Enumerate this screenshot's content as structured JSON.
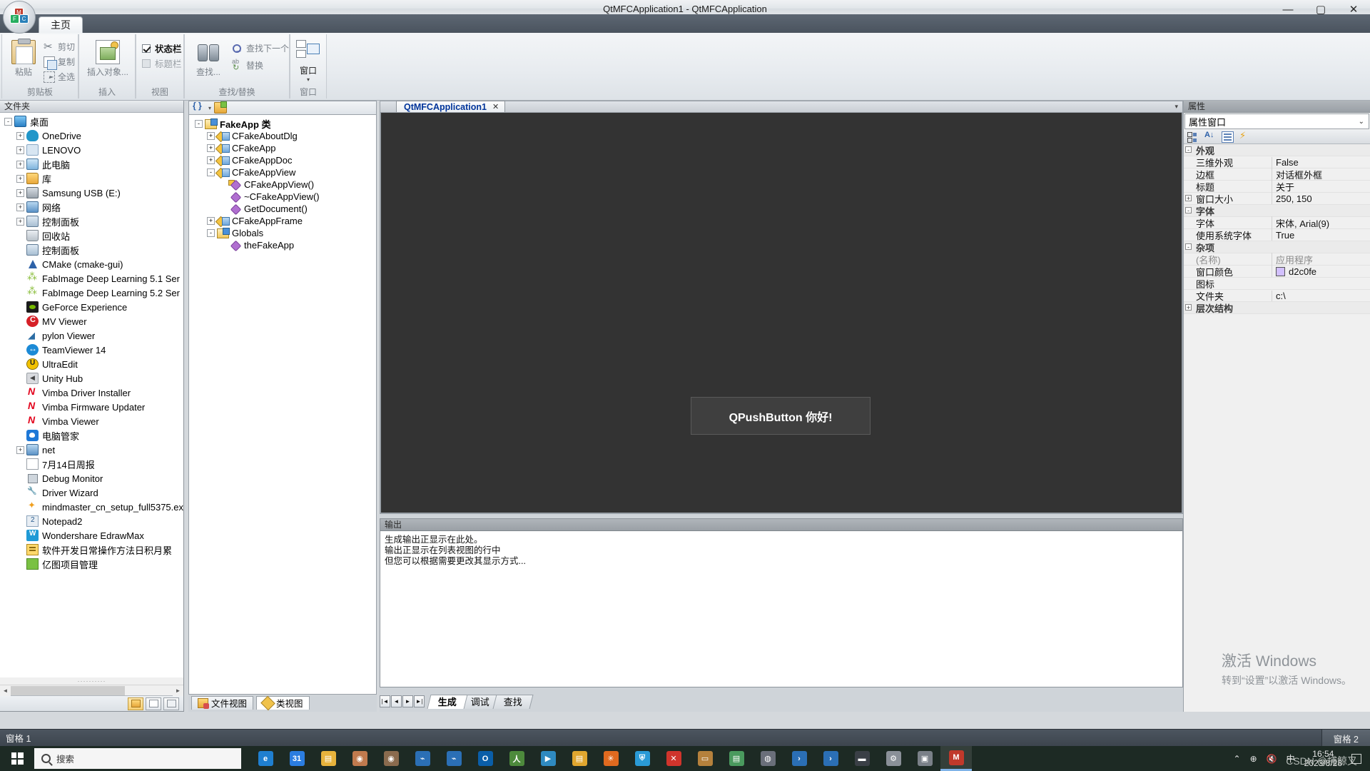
{
  "titlebar": {
    "title": "QtMFCApplication1 - QtMFCApplication",
    "minimize": "—",
    "maximize": "▢",
    "close": "✕"
  },
  "quick_access": {
    "new_label": "new-file",
    "open_label": "open-file",
    "save_label": "save-file",
    "print_label": "print",
    "more_caret": "▾"
  },
  "ribbon": {
    "tab": "主页",
    "groups": [
      {
        "name": "剪贴板"
      },
      {
        "name": "插入"
      },
      {
        "name": "视图"
      },
      {
        "name": "查找/替换"
      },
      {
        "name": "窗口"
      }
    ],
    "clipboard": {
      "paste": "粘贴",
      "cut": "剪切",
      "copy": "复制",
      "select_all": "全选"
    },
    "insert": {
      "insert_object": "插入对象..."
    },
    "view": {
      "status_bar": "状态栏",
      "title_bar": "标题栏",
      "status_bar_checked": true,
      "title_bar_checked": false
    },
    "find": {
      "find": "查找...",
      "find_next": "查找下一个",
      "replace": "替换"
    },
    "window": {
      "window": "窗口",
      "caret": "▾"
    }
  },
  "folder_pane": {
    "caption": "文件夹",
    "tree": [
      {
        "label": "桌面",
        "depth": 0,
        "expander": "-",
        "icon": "i-monitor"
      },
      {
        "label": "OneDrive",
        "depth": 1,
        "expander": "+",
        "icon": "i-cloud"
      },
      {
        "label": "LENOVO",
        "depth": 1,
        "expander": "+",
        "icon": "i-user"
      },
      {
        "label": "此电脑",
        "depth": 1,
        "expander": "+",
        "icon": "i-pc"
      },
      {
        "label": "库",
        "depth": 1,
        "expander": "+",
        "icon": "i-lib"
      },
      {
        "label": "Samsung USB (E:)",
        "depth": 1,
        "expander": "+",
        "icon": "i-usb"
      },
      {
        "label": "网络",
        "depth": 1,
        "expander": "+",
        "icon": "i-net"
      },
      {
        "label": "控制面板",
        "depth": 1,
        "expander": "+",
        "icon": "i-cp"
      },
      {
        "label": "回收站",
        "depth": 1,
        "expander": "",
        "icon": "i-bin"
      },
      {
        "label": "控制面板",
        "depth": 1,
        "expander": "",
        "icon": "i-cp"
      },
      {
        "label": "CMake (cmake-gui)",
        "depth": 1,
        "expander": "",
        "icon": "i-cmake"
      },
      {
        "label": "FabImage Deep Learning 5.1 Ser",
        "depth": 1,
        "expander": "",
        "icon": "i-fab"
      },
      {
        "label": "FabImage Deep Learning 5.2 Ser",
        "depth": 1,
        "expander": "",
        "icon": "i-fab"
      },
      {
        "label": "GeForce Experience",
        "depth": 1,
        "expander": "",
        "icon": "i-gf"
      },
      {
        "label": "MV Viewer",
        "depth": 1,
        "expander": "",
        "icon": "i-mv"
      },
      {
        "label": "pylon Viewer",
        "depth": 1,
        "expander": "",
        "icon": "i-pylon"
      },
      {
        "label": "TeamViewer 14",
        "depth": 1,
        "expander": "",
        "icon": "i-tv"
      },
      {
        "label": "UltraEdit",
        "depth": 1,
        "expander": "",
        "icon": "i-ue"
      },
      {
        "label": "Unity Hub",
        "depth": 1,
        "expander": "",
        "icon": "i-unity"
      },
      {
        "label": "Vimba Driver Installer",
        "depth": 1,
        "expander": "",
        "icon": "i-vimba"
      },
      {
        "label": "Vimba Firmware Updater",
        "depth": 1,
        "expander": "",
        "icon": "i-vimba"
      },
      {
        "label": "Vimba Viewer",
        "depth": 1,
        "expander": "",
        "icon": "i-vimba"
      },
      {
        "label": "电脑管家",
        "depth": 1,
        "expander": "",
        "icon": "i-pcm"
      },
      {
        "label": "net",
        "depth": 1,
        "expander": "+",
        "icon": "i-netfld"
      },
      {
        "label": "7月14日周报",
        "depth": 1,
        "expander": "",
        "icon": "i-doc"
      },
      {
        "label": "Debug Monitor",
        "depth": 1,
        "expander": "",
        "icon": "i-dbg"
      },
      {
        "label": "Driver Wizard",
        "depth": 1,
        "expander": "",
        "icon": "i-drv"
      },
      {
        "label": "mindmaster_cn_setup_full5375.ex",
        "depth": 1,
        "expander": "",
        "icon": "i-mm"
      },
      {
        "label": "Notepad2",
        "depth": 1,
        "expander": "",
        "icon": "i-np"
      },
      {
        "label": "Wondershare EdrawMax",
        "depth": 1,
        "expander": "",
        "icon": "i-wd"
      },
      {
        "label": "软件开发日常操作方法日积月累",
        "depth": 1,
        "expander": "",
        "icon": "i-ydoc"
      },
      {
        "label": "亿图项目管理",
        "depth": 1,
        "expander": "",
        "icon": "i-ygreen"
      }
    ],
    "scroll_left": "◄",
    "scroll_right": "►",
    "grip": "··········"
  },
  "class_pane": {
    "toolbar": {
      "braces": "braces-icon",
      "caret": "▾",
      "new_folder": "new-folder-icon"
    },
    "tree": [
      {
        "label": "FakeApp 类",
        "depth": 0,
        "expander": "-",
        "icon": "ci-proj",
        "bold": true
      },
      {
        "label": "CFakeAboutDlg",
        "depth": 1,
        "expander": "+",
        "icon": "ci-class",
        "bold": false
      },
      {
        "label": "CFakeApp",
        "depth": 1,
        "expander": "+",
        "icon": "ci-class",
        "bold": false
      },
      {
        "label": "CFakeAppDoc",
        "depth": 1,
        "expander": "+",
        "icon": "ci-class",
        "bold": false
      },
      {
        "label": "CFakeAppView",
        "depth": 1,
        "expander": "-",
        "icon": "ci-class",
        "bold": false
      },
      {
        "label": "CFakeAppView()",
        "depth": 2,
        "expander": "",
        "icon": "ci-member key",
        "bold": false
      },
      {
        "label": "~CFakeAppView()",
        "depth": 2,
        "expander": "",
        "icon": "ci-member",
        "bold": false
      },
      {
        "label": "GetDocument()",
        "depth": 2,
        "expander": "",
        "icon": "ci-member",
        "bold": false
      },
      {
        "label": "CFakeAppFrame",
        "depth": 1,
        "expander": "+",
        "icon": "ci-class",
        "bold": false
      },
      {
        "label": "Globals",
        "depth": 1,
        "expander": "-",
        "icon": "ci-proj",
        "bold": false
      },
      {
        "label": "theFakeApp",
        "depth": 2,
        "expander": "",
        "icon": "ci-member",
        "bold": false
      }
    ],
    "tabs": [
      {
        "label": "文件视图",
        "active": false,
        "icon": "tg-file"
      },
      {
        "label": "类视图",
        "active": true,
        "icon": "tg-class"
      }
    ]
  },
  "editor": {
    "tab": {
      "label": "QtMFCApplication1",
      "close": "✕"
    },
    "caret": "▾",
    "canvas_button": "QPushButton 你好!"
  },
  "output": {
    "caption": "输出",
    "lines": [
      "生成输出正显示在此处。",
      "输出正显示在列表视图的行中",
      "但您可以根据需要更改其显示方式..."
    ],
    "nav": {
      "first": "|◄",
      "prev": "◄",
      "next": "►",
      "last": "►|"
    },
    "tabs": [
      {
        "label": "生成",
        "active": true
      },
      {
        "label": "调试",
        "active": false
      },
      {
        "label": "查找",
        "active": false
      }
    ]
  },
  "properties": {
    "caption": "属性",
    "selector": "属性窗口",
    "selector_caret": "⌄",
    "toolbar": [
      "categorize-icon",
      "sort-az-icon",
      "property-pages-icon",
      "events-icon"
    ],
    "rows": [
      {
        "type": "category",
        "expander": "-",
        "name": "外观",
        "value": ""
      },
      {
        "type": "prop",
        "expander": "",
        "name": "三维外观",
        "value": "False"
      },
      {
        "type": "prop",
        "expander": "",
        "name": "边框",
        "value": "对话框外框"
      },
      {
        "type": "prop",
        "expander": "",
        "name": "标题",
        "value": "关于"
      },
      {
        "type": "prop",
        "expander": "+",
        "name": "窗口大小",
        "value": "250, 150"
      },
      {
        "type": "category",
        "expander": "-",
        "name": "字体",
        "value": ""
      },
      {
        "type": "prop",
        "expander": "",
        "name": "字体",
        "value": "宋体, Arial(9)"
      },
      {
        "type": "prop",
        "expander": "",
        "name": "使用系统字体",
        "value": "True"
      },
      {
        "type": "category",
        "expander": "-",
        "name": "杂项",
        "value": ""
      },
      {
        "type": "prop",
        "expander": "",
        "name": "(名称)",
        "value": "应用程序",
        "gray": true
      },
      {
        "type": "prop",
        "expander": "",
        "name": "窗口颜色",
        "value": "d2c0fe",
        "swatch": "#d2c0fe"
      },
      {
        "type": "prop",
        "expander": "",
        "name": "图标",
        "value": ""
      },
      {
        "type": "prop",
        "expander": "",
        "name": "文件夹",
        "value": "c:\\"
      },
      {
        "type": "category",
        "expander": "+",
        "name": "层次结构",
        "value": ""
      }
    ]
  },
  "watermark": {
    "line1": "激活 Windows",
    "line2": "转到“设置”以激活 Windows。"
  },
  "statusbar": {
    "left": "窗格 1",
    "right": "窗格 2"
  },
  "taskbar": {
    "search_placeholder": "搜索",
    "icons": [
      {
        "name": "edge",
        "glyph": "e",
        "color": "#1f7fd0"
      },
      {
        "name": "calendar",
        "glyph": "31",
        "color": "#2b7de0"
      },
      {
        "name": "file-explorer",
        "glyph": "▤",
        "color": "#e8b33c"
      },
      {
        "name": "photos-a",
        "glyph": "◉",
        "color": "#c07a4e"
      },
      {
        "name": "photos-b",
        "glyph": "◉",
        "color": "#8a6b4e"
      },
      {
        "name": "vscode-a",
        "glyph": "⌁",
        "color": "#2b6fb5"
      },
      {
        "name": "vscode-b",
        "glyph": "⌁",
        "color": "#2b6fb5"
      },
      {
        "name": "outlook",
        "glyph": "O",
        "color": "#0a5ea8"
      },
      {
        "name": "person",
        "glyph": "人",
        "color": "#4d8a3c"
      },
      {
        "name": "media",
        "glyph": "▶",
        "color": "#2f8ac0"
      },
      {
        "name": "folder-y",
        "glyph": "▤",
        "color": "#e0a62f"
      },
      {
        "name": "app-orange",
        "glyph": "✳",
        "color": "#e06a1f"
      },
      {
        "name": "shield",
        "glyph": "⛨",
        "color": "#2a9ad6"
      },
      {
        "name": "close-red",
        "glyph": "✕",
        "color": "#d0342c"
      },
      {
        "name": "book",
        "glyph": "▭",
        "color": "#b5813c"
      },
      {
        "name": "notes",
        "glyph": "▤",
        "color": "#4a9a5e"
      },
      {
        "name": "globe",
        "glyph": "◍",
        "color": "#6a6f7a"
      },
      {
        "name": "terminal-a",
        "glyph": "›",
        "color": "#2b6fb5"
      },
      {
        "name": "terminal-b",
        "glyph": "›",
        "color": "#2b6fb5"
      },
      {
        "name": "console",
        "glyph": "▬",
        "color": "#3a3f46"
      },
      {
        "name": "settings",
        "glyph": "⚙",
        "color": "#8a9098"
      },
      {
        "name": "tool",
        "glyph": "▣",
        "color": "#7a8088"
      },
      {
        "name": "mfc-app",
        "glyph": "M",
        "color": "#c0392b"
      }
    ],
    "tray": {
      "chevron": "⌃",
      "network": "⊕",
      "volume": "🔇",
      "ime": "中"
    },
    "clock": {
      "time": "16:54",
      "date": "2023/8/28"
    },
    "csdn": "CSDN @捕鲸叉"
  }
}
